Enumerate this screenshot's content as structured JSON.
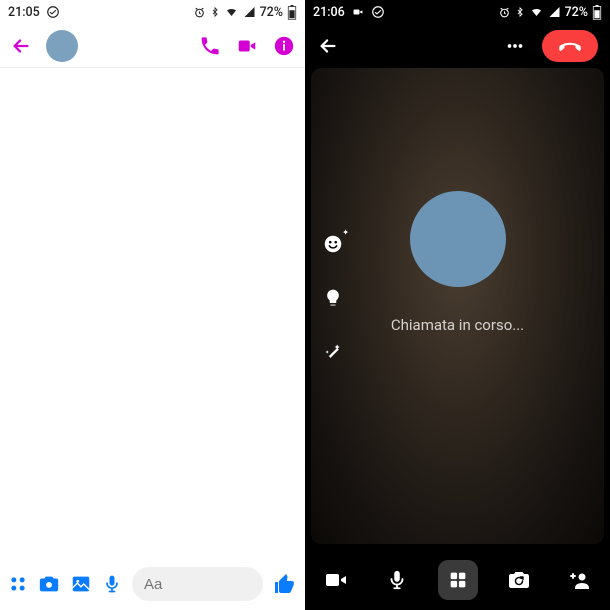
{
  "left": {
    "status": {
      "time": "21:05",
      "battery": "72%"
    },
    "composer_placeholder": "Aa"
  },
  "right": {
    "status": {
      "time": "21:06",
      "battery": "72%"
    },
    "call_status_text": "Chiamata in corso..."
  },
  "colors": {
    "messenger_accent": "#0a7cff",
    "magenta": "#d400d4",
    "hangup": "#fa3e3e",
    "avatar": "#6c95b5"
  }
}
